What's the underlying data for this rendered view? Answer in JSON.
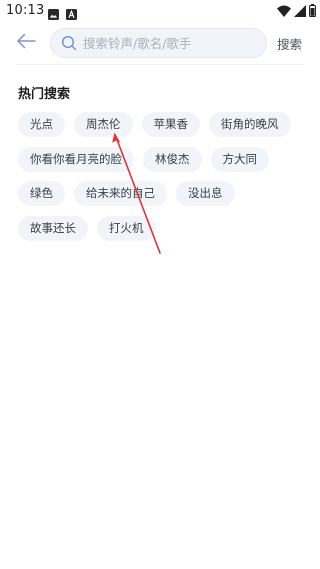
{
  "status_bar": {
    "time": "10:13",
    "notification_icons": [
      "image-icon",
      "a-icon"
    ],
    "system_icons": [
      "wifi-icon",
      "signal-icon",
      "battery-icon"
    ]
  },
  "header": {
    "back_icon": "arrow-left-icon",
    "search_placeholder": "搜索铃声/歌名/歌手",
    "search_value": "",
    "search_button_label": "搜索"
  },
  "hot_search": {
    "title": "热门搜索",
    "rows": [
      [
        "光点",
        "周杰伦",
        "苹果香",
        "街角的晚风"
      ],
      [
        "你看你看月亮的脸",
        "林俊杰",
        "方大同"
      ],
      [
        "绿色",
        "给未来的自己",
        "没出息"
      ],
      [
        "故事还长",
        "打火机"
      ]
    ]
  },
  "annotation": {
    "arrow_color": "#d9353a",
    "points_to": "周杰伦"
  },
  "colors": {
    "tag_background": "#f1f4f9",
    "accent_icon": "#6f8fd6"
  }
}
